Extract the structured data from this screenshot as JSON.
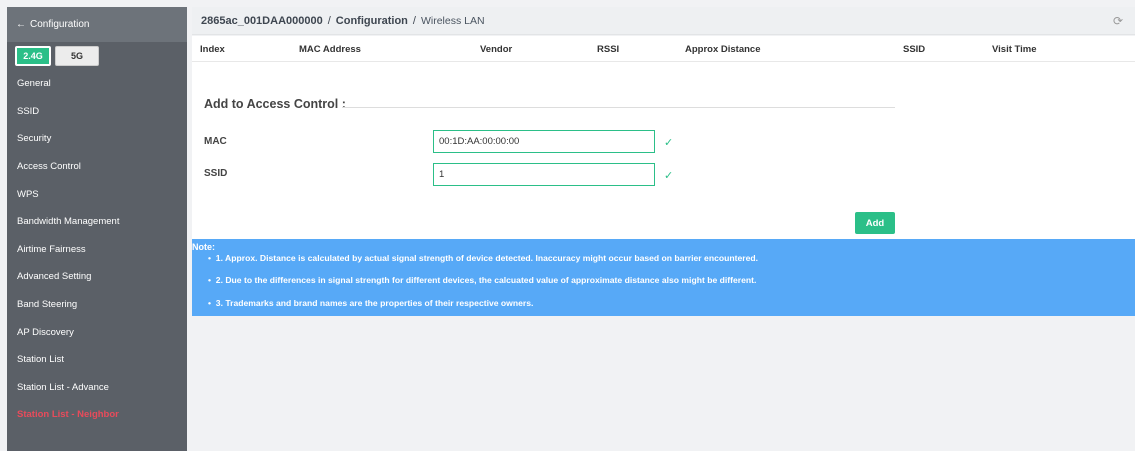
{
  "sidebar": {
    "back_label": "Configuration",
    "bands": [
      "2.4G",
      "5G"
    ],
    "items": [
      "General",
      "SSID",
      "Security",
      "Access Control",
      "WPS",
      "Bandwidth Management",
      "Airtime Fairness",
      "Advanced Setting",
      "Band Steering",
      "AP Discovery",
      "Station List",
      "Station List - Advance",
      "Station List - Neighbor"
    ]
  },
  "header": {
    "device": "2865ac_001DAA000000",
    "section": "Configuration",
    "page": "Wireless LAN"
  },
  "table": {
    "columns": [
      "Index",
      "MAC Address",
      "Vendor",
      "RSSI",
      "Approx Distance",
      "SSID",
      "Visit Time"
    ]
  },
  "form": {
    "title": "Add to Access Control :",
    "mac_label": "MAC",
    "mac_value": "00:1D:AA:00:00:00",
    "ssid_label": "SSID",
    "ssid_value": "1",
    "add_label": "Add"
  },
  "notes": {
    "title": "Note:",
    "items": [
      "1. Approx. Distance is calculated by actual signal strength of device detected. Inaccuracy might occur based on barrier encountered.",
      "2. Due to the differences in signal strength for different devices, the calcuated value of approximate distance also might be different.",
      "3. Trademarks and brand names are the properties of their respective owners."
    ]
  },
  "colors": {
    "accent": "#2bbf88",
    "active_item": "#e94b5b",
    "note_bg": "#57a9f7",
    "sidebar_bg": "#5b6067"
  }
}
